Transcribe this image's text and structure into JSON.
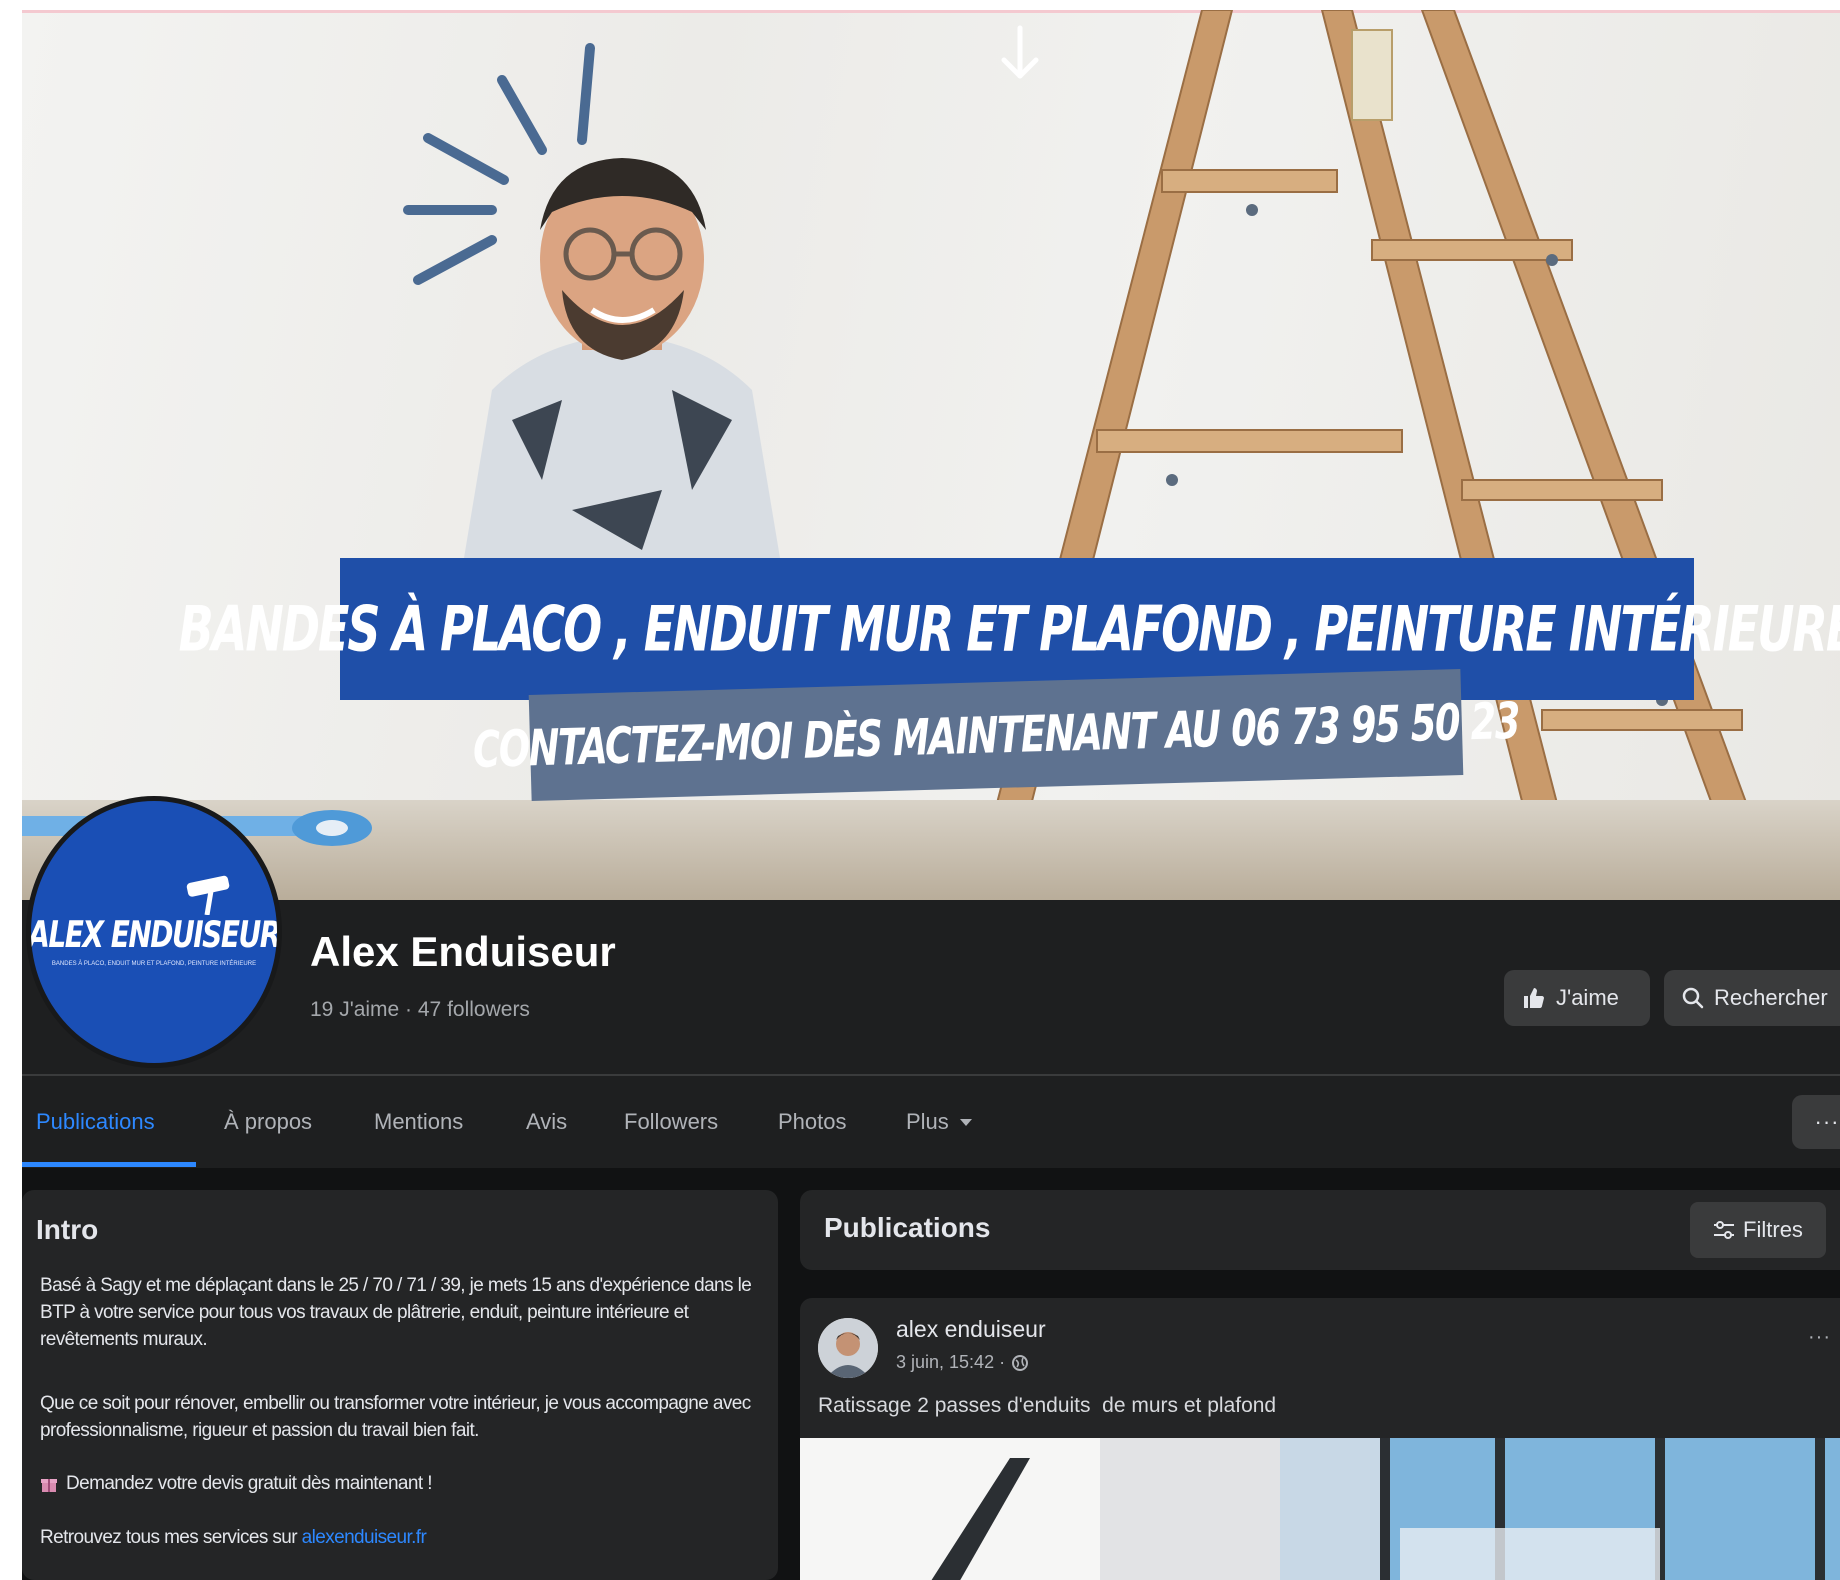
{
  "cover": {
    "headline": "BANDES À PLACO , ENDUIT MUR ET PLAFOND , PEINTURE INTÉRIEURE",
    "contact_line": "CONTACTEZ-MOI DÈS MAINTENANT  AU 06 73 95 50 23",
    "icons": [
      "down-arrow-icon",
      "sparkle-doodle-icon",
      "ladder-illustration",
      "person-photo"
    ]
  },
  "profile": {
    "logo_text": "ALEX ENDUISEUR",
    "logo_subtext": "BANDES À PLACO, ENDUIT MUR ET PLAFOND, PEINTURE INTÉRIEURE",
    "brand_color": "#1a4fb5"
  },
  "header": {
    "page_name": "Alex Enduiseur",
    "stats": "19 J'aime · 47 followers",
    "like_button": "J'aime",
    "search_button": "Rechercher"
  },
  "tabs": {
    "active_color": "#2d88ff",
    "items": [
      {
        "label": "Publications",
        "active": true
      },
      {
        "label": "À propos"
      },
      {
        "label": "Mentions"
      },
      {
        "label": "Avis"
      },
      {
        "label": "Followers"
      },
      {
        "label": "Photos"
      },
      {
        "label": "Plus"
      }
    ],
    "more_menu": "···"
  },
  "intro": {
    "title": "Intro",
    "p1": "Basé à Sagy et me déplaçant dans le 25 / 70 / 71 / 39, je mets 15 ans d'expérience dans le BTP à votre service pour tous vos travaux de plâtrerie, enduit, peinture intérieure et revêtements muraux.",
    "p2": "Que ce soit pour rénover, embellir ou transformer votre intérieur, je vous accompagne avec professionnalisme, rigueur et passion du travail bien fait.",
    "p3": "Demandez votre devis gratuit dès maintenant !",
    "p4_prefix": "Retrouvez tous mes services sur ",
    "p4_link": "alexenduiseur.fr"
  },
  "publications": {
    "title": "Publications",
    "filters_button": "Filtres",
    "post": {
      "author": "alex enduiseur",
      "time": "3 juin, 15:42 ·",
      "text": "Ratissage 2 passes d'enduits  de murs et plafond",
      "menu": "···"
    }
  }
}
